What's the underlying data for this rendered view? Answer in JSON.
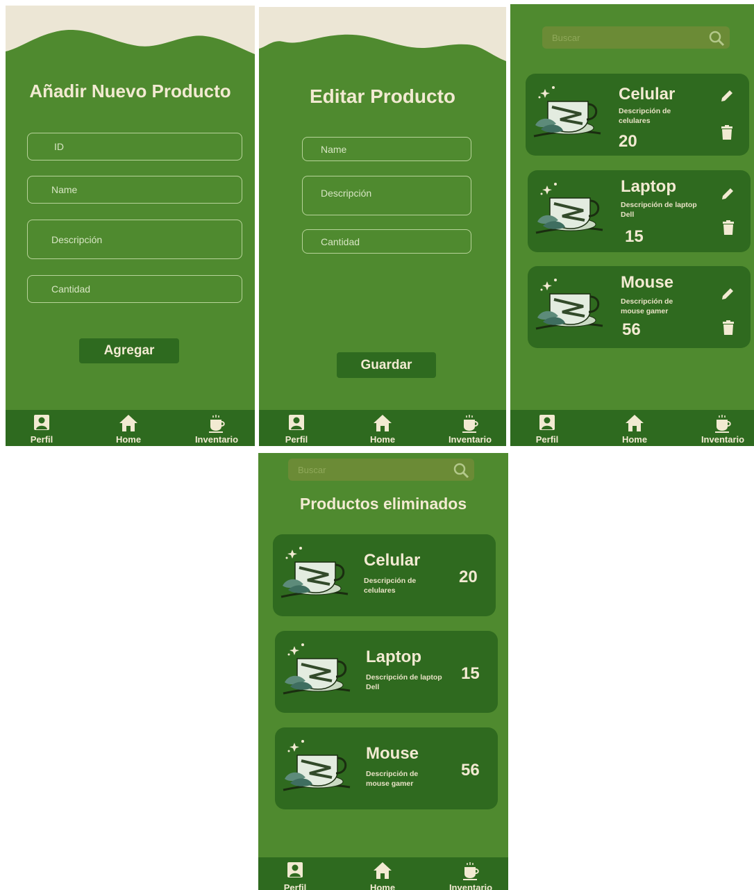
{
  "colors": {
    "screen_bg": "#4f8a2f",
    "wave_bg": "#ece6d5",
    "card_bg": "#2f6a1f",
    "navbar_bg": "#2e6a1f",
    "text_cream": "#f2ead2",
    "field_border": "#b8d49a",
    "search_bg": "#6b8b36"
  },
  "add_screen": {
    "title": "Añadir Nuevo Producto",
    "fields": {
      "id": "ID",
      "name": "Name",
      "description": "Descripción",
      "quantity": "Cantidad"
    },
    "submit_label": "Agregar"
  },
  "edit_screen": {
    "title": "Editar Producto",
    "fields": {
      "name": "Name",
      "description": "Descripción",
      "quantity": "Cantidad"
    },
    "submit_label": "Guardar"
  },
  "inventory_screen": {
    "search_placeholder": "Buscar",
    "products": [
      {
        "name": "Celular",
        "description": "Descripción de celulares",
        "quantity": "20"
      },
      {
        "name": "Laptop",
        "description": "Descripción de laptop Dell",
        "quantity": "15"
      },
      {
        "name": "Mouse",
        "description": "Descripción de mouse gamer",
        "quantity": "56"
      }
    ]
  },
  "deleted_screen": {
    "search_placeholder": "Buscar",
    "title": "Productos eliminados",
    "products": [
      {
        "name": "Celular",
        "description": "Descripción de celulares",
        "quantity": "20"
      },
      {
        "name": "Laptop",
        "description": "Descripción de laptop Dell",
        "quantity": "15"
      },
      {
        "name": "Mouse",
        "description": "Descripción de mouse gamer",
        "quantity": "56"
      }
    ]
  },
  "navbar": {
    "profile": "Perfil",
    "home": "Home",
    "inventory": "Inventario"
  },
  "icons": {
    "profile": "person-icon",
    "home": "home-icon",
    "inventory": "coffee-cup-icon",
    "edit": "pencil-icon",
    "delete": "trash-icon",
    "search": "search-icon",
    "product": "tea-cup-icon"
  }
}
